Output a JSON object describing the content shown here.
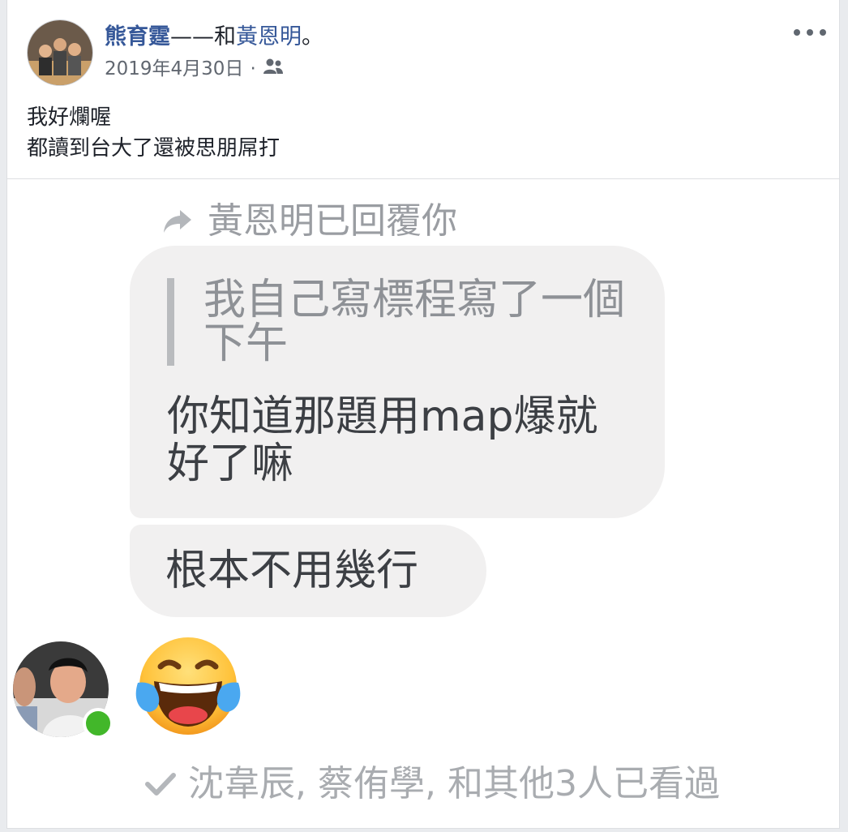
{
  "post": {
    "author": "熊育霆",
    "tag_separator": "——和",
    "tagged": "黃恩明",
    "tag_end": "。",
    "date": "2019年4月30日",
    "dot": "·",
    "privacy_icon": "friends-icon",
    "text_lines": [
      "我好爛喔",
      "都讀到台大了還被思朋屌打"
    ]
  },
  "screenshot": {
    "reply_note": "黃恩明已回覆你",
    "quoted_message": "我自己寫標程寫了一個下午",
    "message_1": "你知道那題用map爆就好了嘛",
    "message_2": "根本不用幾行",
    "emoji": "laughing-with-tears-emoji",
    "seen_note": "沈韋辰, 蔡侑學, 和其他3人已看過"
  },
  "colors": {
    "link": "#365899",
    "online": "#42b72a",
    "bubble": "#f1f0f0"
  }
}
